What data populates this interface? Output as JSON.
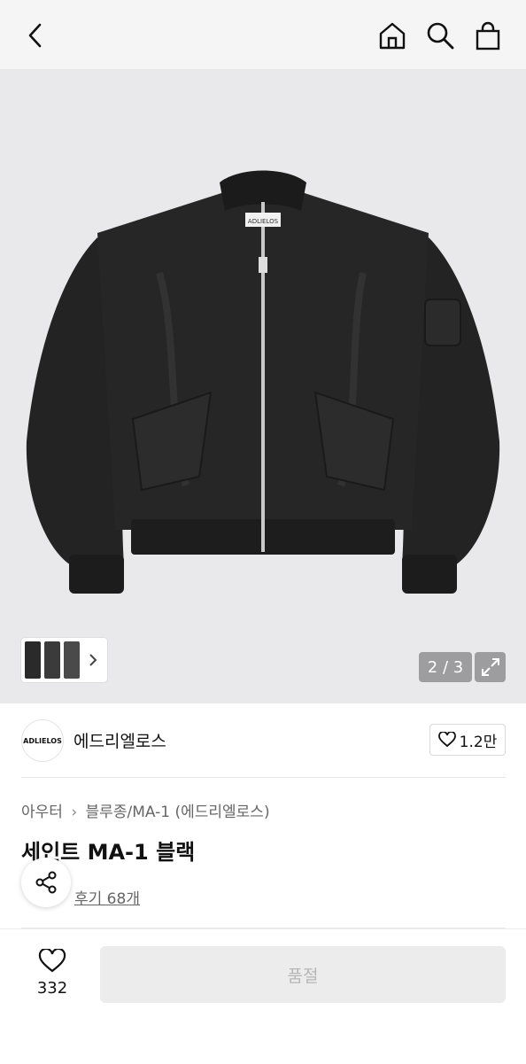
{
  "header": {
    "back_icon": "chevron-left-icon",
    "home_icon": "home-icon",
    "search_icon": "search-icon",
    "cart_icon": "shopping-bag-icon"
  },
  "gallery": {
    "counter": "2 / 3",
    "expand_icon": "expand-icon",
    "thumbs_icon": "chevron-right-icon"
  },
  "brand": {
    "logo_text": "ADLIELOS",
    "name": "에드리엘로스",
    "likes": "1.2만"
  },
  "product": {
    "breadcrumb": [
      "아우터",
      "블루종/MA-1 (에드리엘로스)"
    ],
    "title": "세인트 MA-1 블랙",
    "review_link": "후기 68개",
    "jacket_label": "ADLIELOS"
  },
  "bottom": {
    "wish_count": "332",
    "buy_button": "품절"
  }
}
